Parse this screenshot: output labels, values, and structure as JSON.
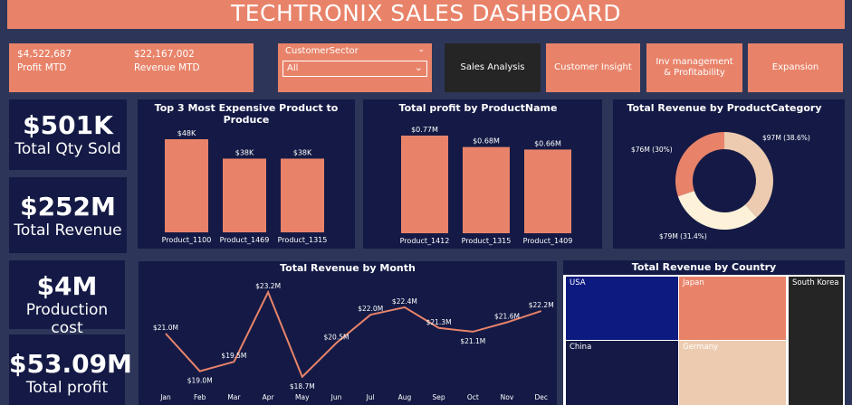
{
  "header": {
    "title": "TECHTRONIX SALES DASHBOARD"
  },
  "top_kpis": [
    {
      "value": "$4,522,687",
      "label": "Profit MTD"
    },
    {
      "value": "$22,167,002",
      "label": "Revenue MTD"
    }
  ],
  "filter": {
    "label": "CustomerSector",
    "selected": "All"
  },
  "nav": {
    "sales_analysis": "Sales Analysis",
    "customer_insight": "Customer Insight",
    "inv_management": "Inv management & Profitability",
    "expansion": "Expansion"
  },
  "kpis": [
    {
      "value": "$501K",
      "label": "Total Qty Sold"
    },
    {
      "value": "$252M",
      "label": "Total Revenue"
    },
    {
      "value": "$4M",
      "label": "Production cost"
    },
    {
      "value": "$53.09M",
      "label": "Total profit"
    }
  ],
  "colors": {
    "accent": "#e8836a",
    "panel": "#141a45",
    "background": "#2d3659",
    "navy": "#0d1a80",
    "dark": "#252525",
    "beige": "#eccbb0",
    "cream": "#fdf1d9"
  },
  "chart_data": [
    {
      "type": "bar",
      "title": "Top 3 Most Expensive Product to Produce",
      "categories": [
        "Product_1100",
        "Product_1469",
        "Product_1315"
      ],
      "values": [
        48,
        38,
        38
      ],
      "data_labels": [
        "$48K",
        "$38K",
        "$38K"
      ],
      "unit": "K$"
    },
    {
      "type": "bar",
      "title": "Total profit by ProductName",
      "categories": [
        "Product_1412",
        "Product_1315",
        "Product_1409"
      ],
      "values": [
        0.77,
        0.68,
        0.66
      ],
      "data_labels": [
        "$0.77M",
        "$0.68M",
        "$0.66M"
      ],
      "unit": "M$"
    },
    {
      "type": "pie",
      "title": "Total Revenue by ProductCategory",
      "slices": [
        {
          "value": 97,
          "label": "$97M (38.6%)",
          "color": "#eccbb0"
        },
        {
          "value": 79,
          "label": "$79M (31.4%)",
          "color": "#fdf1d9"
        },
        {
          "value": 76,
          "label": "$76M (30%)",
          "color": "#e8836a"
        }
      ]
    },
    {
      "type": "line",
      "title": "Total Revenue by Month",
      "categories": [
        "Jan",
        "Feb",
        "Mar",
        "Apr",
        "May",
        "Jun",
        "Jul",
        "Aug",
        "Sep",
        "Oct",
        "Nov",
        "Dec"
      ],
      "values": [
        21.0,
        19.0,
        19.5,
        23.2,
        18.7,
        20.5,
        22.0,
        22.4,
        21.3,
        21.1,
        21.6,
        22.2
      ],
      "data_labels": [
        "$21.0M",
        "$19.0M",
        "$19.5M",
        "$23.2M",
        "$18.7M",
        "$20.5M",
        "$22.0M",
        "$22.4M",
        "$21.3M",
        "$21.1M",
        "$21.6M",
        "$22.2M"
      ],
      "ylim": [
        18.5,
        23.5
      ]
    },
    {
      "type": "treemap",
      "title": "Total Revenue by Country",
      "items": [
        {
          "name": "USA",
          "color": "#0d1a80"
        },
        {
          "name": "Japan",
          "color": "#e8836a"
        },
        {
          "name": "South Korea",
          "color": "#252525"
        },
        {
          "name": "China",
          "color": "#141a45"
        },
        {
          "name": "Germany",
          "color": "#eccbb0"
        }
      ]
    }
  ]
}
